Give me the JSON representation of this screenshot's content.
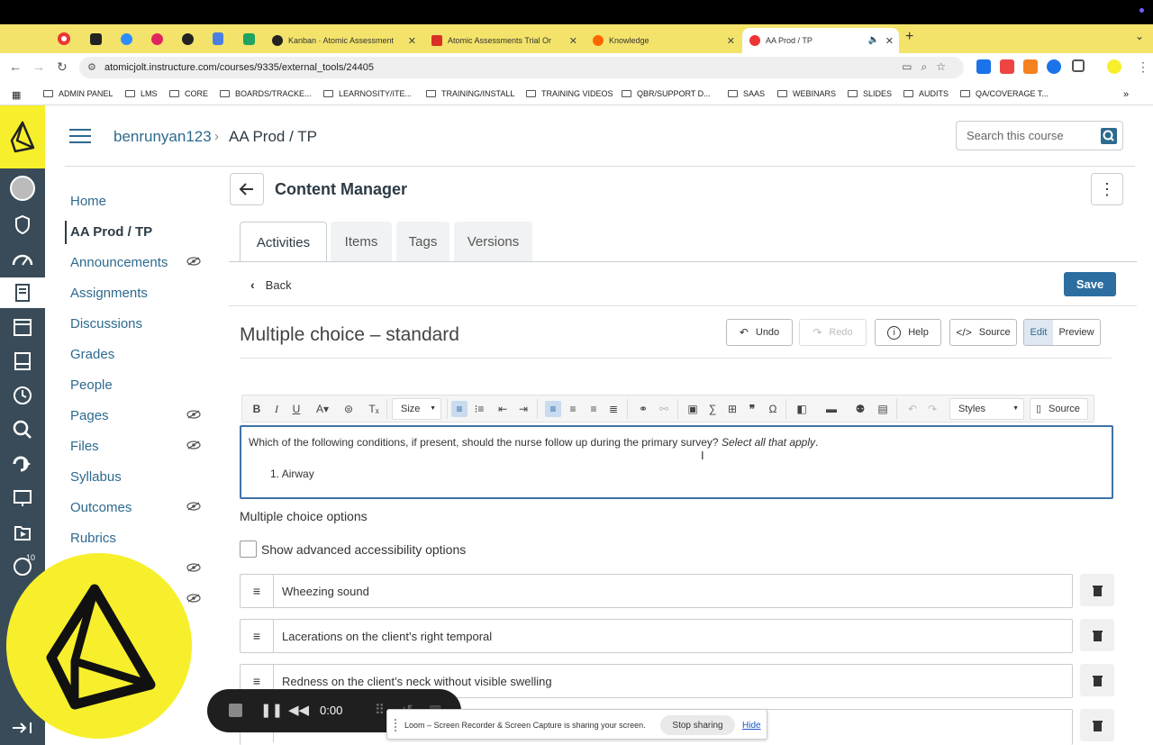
{
  "browser": {
    "tabs": [
      {
        "title": "Kanban · Atomic Assessment"
      },
      {
        "title": "Atomic Assessments Trial Or"
      },
      {
        "title": "Knowledge"
      },
      {
        "title": "AA Prod / TP"
      }
    ],
    "url": "atomicjolt.instructure.com/courses/9335/external_tools/24405",
    "bookmarks": [
      "ADMIN PANEL",
      "LMS",
      "CORE",
      "BOARDS/TRACKE...",
      "LEARNOSITY/ITE...",
      "TRAINING/INSTALL",
      "TRAINING VIDEOS",
      "QBR/SUPPORT D...",
      "SAAS",
      "WEBINARS",
      "SLIDES",
      "AUDITS",
      "QA/COVERAGE T..."
    ]
  },
  "header": {
    "course": "benrunyan123",
    "page": "AA Prod / TP",
    "search_placeholder": "Search this course"
  },
  "global_nav": {
    "badge": "10"
  },
  "course_nav": {
    "items": [
      "Home",
      "AA Prod / TP",
      "Announcements",
      "Assignments",
      "Discussions",
      "Grades",
      "People",
      "Pages",
      "Files",
      "Syllabus",
      "Outcomes",
      "Rubrics"
    ]
  },
  "content_manager": {
    "title": "Content Manager",
    "tabs": [
      "Activities",
      "Items",
      "Tags",
      "Versions"
    ],
    "back": "Back",
    "save": "Save"
  },
  "question": {
    "title": "Multiple choice – standard",
    "toolbar": {
      "undo": "Undo",
      "redo": "Redo",
      "help": "Help",
      "source": "Source",
      "edit": "Edit",
      "preview": "Preview"
    },
    "editor": {
      "size": "Size",
      "styles": "Styles",
      "source": "Source"
    },
    "stem": "Which of the following conditions, if present, should the nurse follow up during the primary survey? ",
    "stem_em": "Select all that apply",
    "stem_end": ".",
    "list_item_number": "1.",
    "list_item": "Airway",
    "options_label": "Multiple choice options",
    "accessibility_label": "Show advanced accessibility options",
    "options": [
      "Wheezing sound",
      "Lacerations on the client’s right temporal",
      "Redness on the client’s neck without visible swelling"
    ]
  },
  "loom": {
    "timer": "0:00",
    "banner": "Loom – Screen Recorder & Screen Capture is sharing your screen.",
    "stop": "Stop sharing",
    "hide": "Hide"
  },
  "colors": {
    "canvas_nav": "#394b58",
    "accent_yellow": "#f7ef2c",
    "link": "#2d6a8f",
    "save": "#2d6ea0"
  }
}
